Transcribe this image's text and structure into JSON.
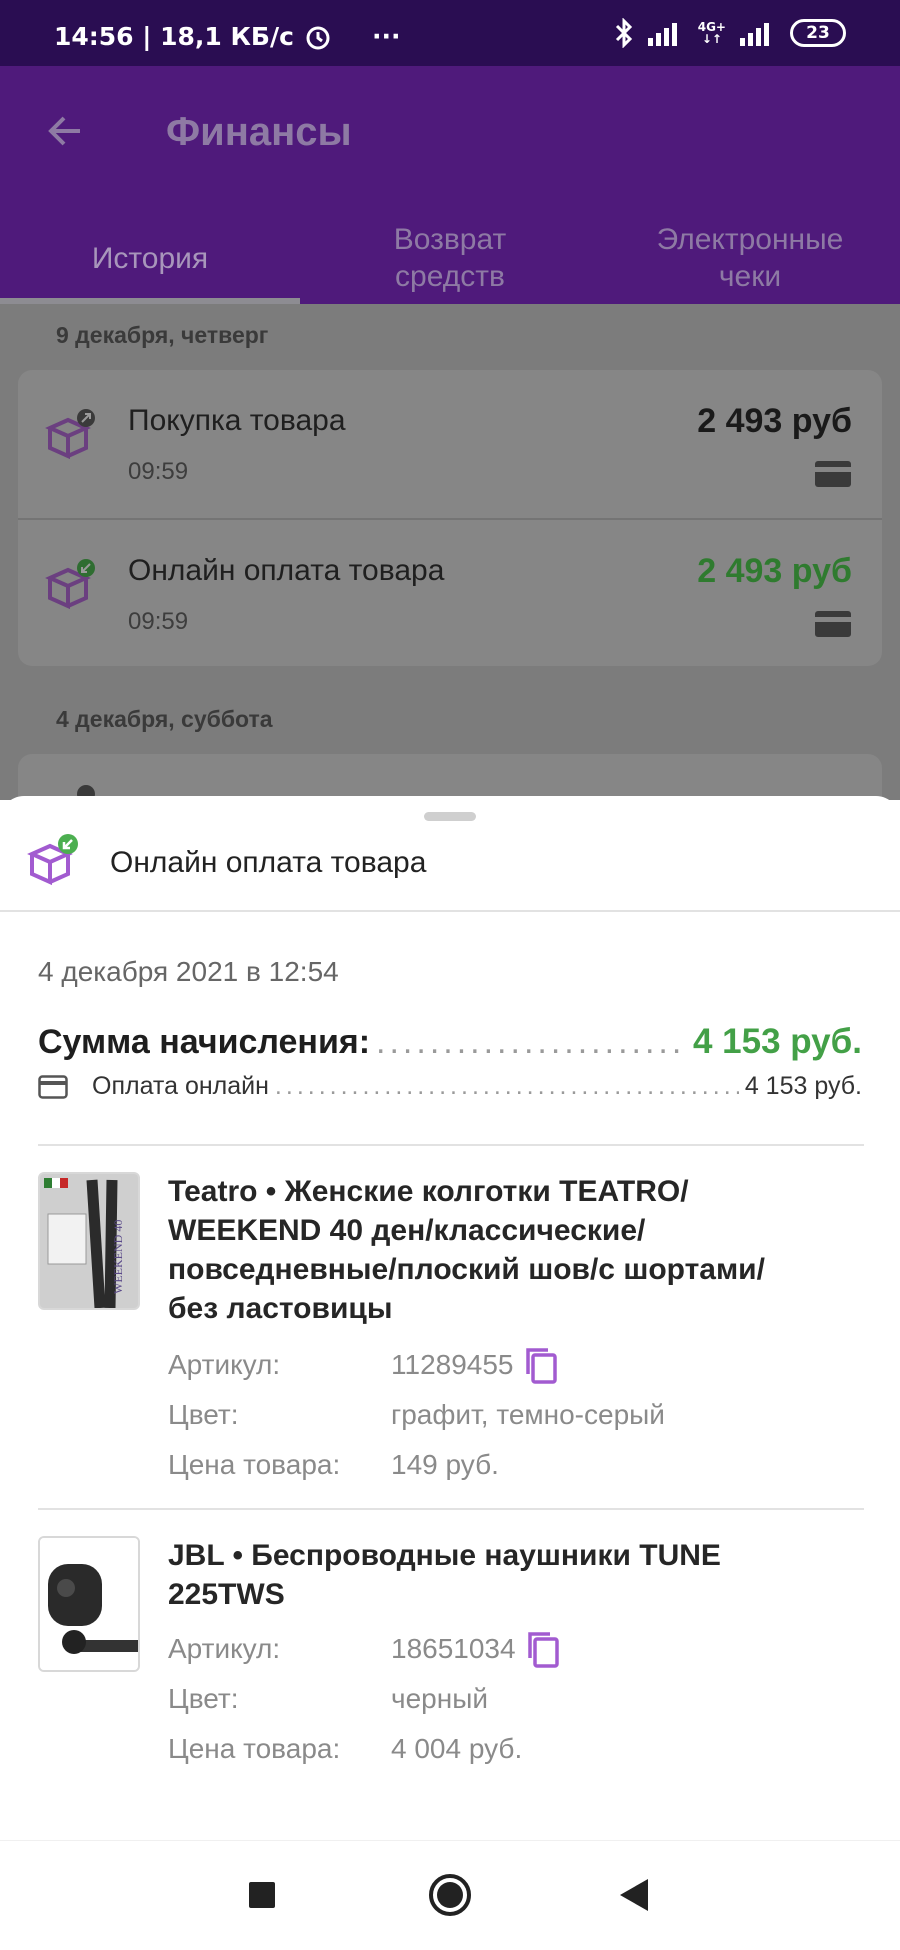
{
  "status_bar": {
    "time_speed": "14:56 | 18,1 КБ/с",
    "more": "···",
    "network_top": "4G+",
    "network_bottom": "↓↑",
    "battery": "23"
  },
  "header": {
    "title": "Финансы",
    "tabs": [
      {
        "line1": "История",
        "line2": ""
      },
      {
        "line1": "Возврат",
        "line2": "средств"
      },
      {
        "line1": "Электронные",
        "line2": "чеки"
      }
    ],
    "active_tab": "История"
  },
  "history": {
    "groups": [
      {
        "date": "9 декабря, четверг",
        "rows": [
          {
            "title": "Покупка товара",
            "time": "09:59",
            "amount": "2 493 руб",
            "amount_color": "#1a1a1a",
            "badge": "outgoing"
          },
          {
            "title": "Онлайн оплата товара",
            "time": "09:59",
            "amount": "2 493 руб",
            "amount_color": "#43a047",
            "badge": "incoming"
          }
        ]
      },
      {
        "date": "4 декабря, суббота",
        "rows": []
      }
    ]
  },
  "sheet": {
    "title": "Онлайн оплата товара",
    "date": "4 декабря 2021 в 12:54",
    "sum_label": "Сумма начисления:",
    "sum_value": "4 153 руб.",
    "payment_label": "Оплата онлайн",
    "payment_value": "4 153 руб.",
    "items": [
      {
        "name": "Teatro • Женские колготки TEATRO/ WEEKEND 40 ден/классические/ повседневные/плоский шов/с шортами/ без ластовицы",
        "name_lines": [
          "Teatro • Женские колготки TEATRO/",
          "WEEKEND 40 ден/классические/",
          "повседневные/плоский шов/с шортами/",
          "без ластовицы"
        ],
        "thumb_icon": "tights-package-image",
        "thumb_text": "WEEKEND 40",
        "article_label": "Артикул:",
        "article": "11289455",
        "color_label": "Цвет:",
        "color": "графит, темно-серый",
        "price_label": "Цена товара:",
        "price": "149 руб."
      },
      {
        "name": "JBL • Беспроводные наушники TUNE 225TWS",
        "name_lines": [
          "JBL • Беспроводные наушники TUNE",
          "225TWS"
        ],
        "thumb_icon": "earbuds-image",
        "article_label": "Артикул:",
        "article": "18651034",
        "color_label": "Цвет:",
        "color": "черный",
        "price_label": "Цена товара:",
        "price": "4 004 руб."
      }
    ]
  },
  "navbar": {
    "buttons": [
      "recents-icon",
      "home-icon",
      "back-icon"
    ]
  },
  "colors": {
    "status_bar": "#2a0d52",
    "header": "#4f1a7b",
    "accent_purple": "#a25bd0",
    "green": "#43a047",
    "badge_green": "#4caf50"
  }
}
